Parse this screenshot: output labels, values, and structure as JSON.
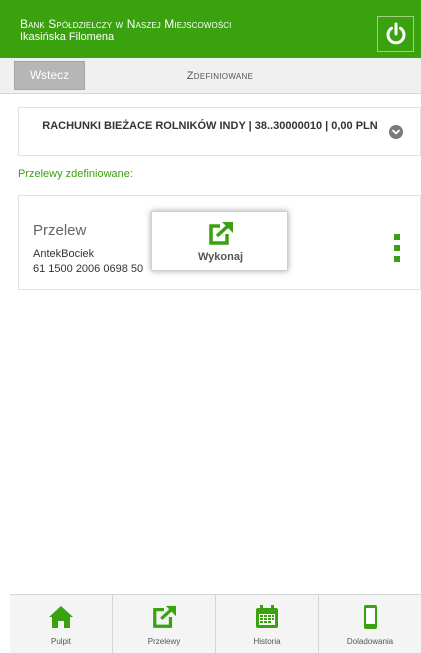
{
  "header": {
    "bank_name": "Bank Spółdzielczy w Naszej Miejscowości",
    "user_name": "Ikasińska Filomena"
  },
  "nav": {
    "back_label": "Wstecz",
    "title": "Zdefiniowane"
  },
  "account": {
    "text": "RACHUNKI BIEŻACE ROLNIKÓW INDY | 38..30000010 | 0,00 PLN"
  },
  "section": {
    "label": "Przelewy zdefiniowane:"
  },
  "transfer": {
    "title": "Przelew",
    "recipient": "AntekBociek",
    "account_number": "61 1500 2006 0698 50"
  },
  "popup": {
    "label": "Wykonaj"
  },
  "tabs": [
    {
      "label": "Pulpit",
      "icon": "home-icon"
    },
    {
      "label": "Przelewy",
      "icon": "transfer-icon"
    },
    {
      "label": "Historia",
      "icon": "calendar-icon"
    },
    {
      "label": "Doladowania",
      "icon": "phone-icon"
    }
  ],
  "colors": {
    "brand_green": "#3aa10f",
    "nav_bg": "#f0f0f0",
    "back_button_bg": "#b6b6b6"
  }
}
